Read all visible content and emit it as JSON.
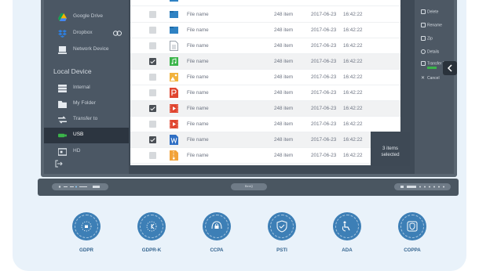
{
  "sidebar": {
    "cloud_items": [
      {
        "label": "Google Drive",
        "icon": "google-drive-icon"
      },
      {
        "label": "Dropbox",
        "icon": "dropbox-icon"
      },
      {
        "label": "Network Device",
        "icon": "network-device-icon"
      }
    ],
    "local_heading": "Local Device",
    "local_items": [
      {
        "label": "Internal",
        "icon": "internal-storage-icon"
      },
      {
        "label": "My Folder",
        "icon": "folder-icon"
      },
      {
        "label": "Transfer to",
        "icon": "transfer-icon"
      },
      {
        "label": "USB",
        "icon": "usb-icon",
        "active": true
      },
      {
        "label": "HD",
        "icon": "hd-icon"
      }
    ]
  },
  "files": [
    {
      "name": "File name",
      "size": "248 item",
      "date": "2017-06-23",
      "time": "16:42:22",
      "type": "folder",
      "checked": false
    },
    {
      "name": "File name",
      "size": "248 item",
      "date": "2017-06-23",
      "time": "16:42:22",
      "type": "folder",
      "checked": false
    },
    {
      "name": "File name",
      "size": "248 item",
      "date": "2017-06-23",
      "time": "16:42:22",
      "type": "document",
      "checked": false
    },
    {
      "name": "File name",
      "size": "248 item",
      "date": "2017-06-23",
      "time": "16:42:22",
      "type": "audio",
      "checked": true
    },
    {
      "name": "File name",
      "size": "248 item",
      "date": "2017-06-23",
      "time": "16:42:22",
      "type": "image",
      "checked": false
    },
    {
      "name": "File name",
      "size": "248 item",
      "date": "2017-06-23",
      "time": "16:42:22",
      "type": "powerpoint",
      "checked": false
    },
    {
      "name": "File name",
      "size": "248 item",
      "date": "2017-06-23",
      "time": "16:42:22",
      "type": "video",
      "checked": true
    },
    {
      "name": "File name",
      "size": "248 item",
      "date": "2017-06-23",
      "time": "16:42:22",
      "type": "video",
      "checked": false
    },
    {
      "name": "File name",
      "size": "248 item",
      "date": "2017-06-23",
      "time": "16:42:22",
      "type": "word",
      "checked": true
    },
    {
      "name": "File name",
      "size": "248 item",
      "date": "2017-06-23",
      "time": "16:42:22",
      "type": "zip",
      "checked": false
    }
  ],
  "actions": [
    {
      "label": "Delete",
      "icon": "delete-icon"
    },
    {
      "label": "Rename",
      "icon": "rename-icon"
    },
    {
      "label": "Zip",
      "icon": "zip-icon"
    },
    {
      "label": "Details",
      "icon": "details-icon"
    },
    {
      "label": "Transfer To",
      "icon": "transfer-to-icon"
    },
    {
      "label": "Cancel",
      "icon": "cancel-icon"
    }
  ],
  "selection": {
    "count_text": "3 items",
    "status_text": "selected"
  },
  "bezel": {
    "brand": "BenQ"
  },
  "compliance": [
    {
      "name": "GDPR",
      "icon": "gdpr-stars-icon"
    },
    {
      "name": "GDPR-K",
      "icon": "gdpr-k-stars-icon"
    },
    {
      "name": "CCPA",
      "icon": "ccpa-lock-icon"
    },
    {
      "name": "PSTI",
      "icon": "psti-shield-icon"
    },
    {
      "name": "ADA",
      "icon": "ada-accessibility-icon"
    },
    {
      "name": "COPPA",
      "icon": "coppa-shield-icon"
    }
  ],
  "colors": {
    "accent_green": "#3bb54a",
    "badge_blue": "#3d7fb6",
    "screen_dark": "#3f4a56"
  }
}
